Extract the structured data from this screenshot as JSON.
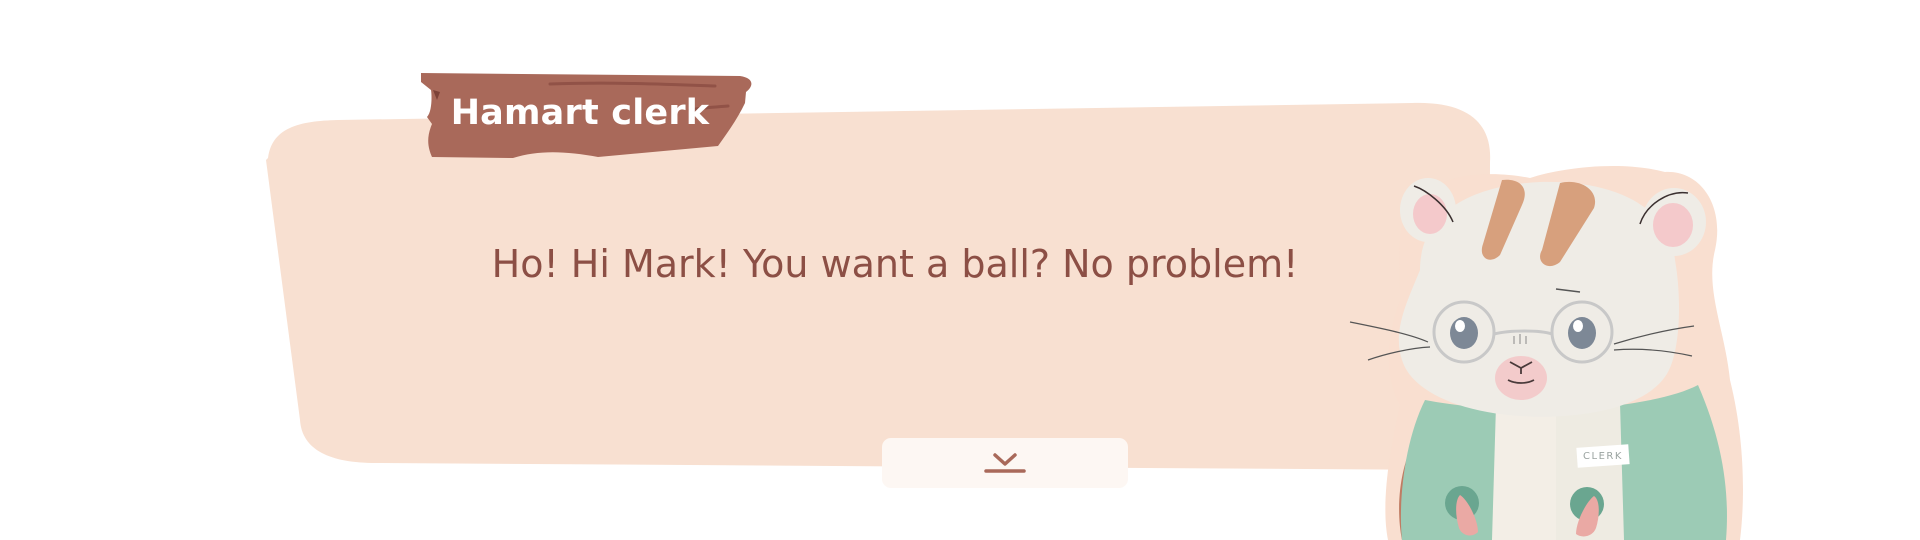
{
  "dialog": {
    "speaker_name": "Hamart clerk",
    "message": "Ho! Hi Mark! You want a ball? No problem!",
    "continue_icon": "chevron-down-with-underline-icon"
  },
  "character": {
    "portrait": "hamster-clerk-with-glasses",
    "badge_text": "CLERK"
  },
  "colors": {
    "bubble_background": "#f8e0d1",
    "name_plate": "#a9695a",
    "message_text": "#8c4f45",
    "continue_button_bg": "#fdf7f3",
    "apron": "#9ccbb5"
  }
}
